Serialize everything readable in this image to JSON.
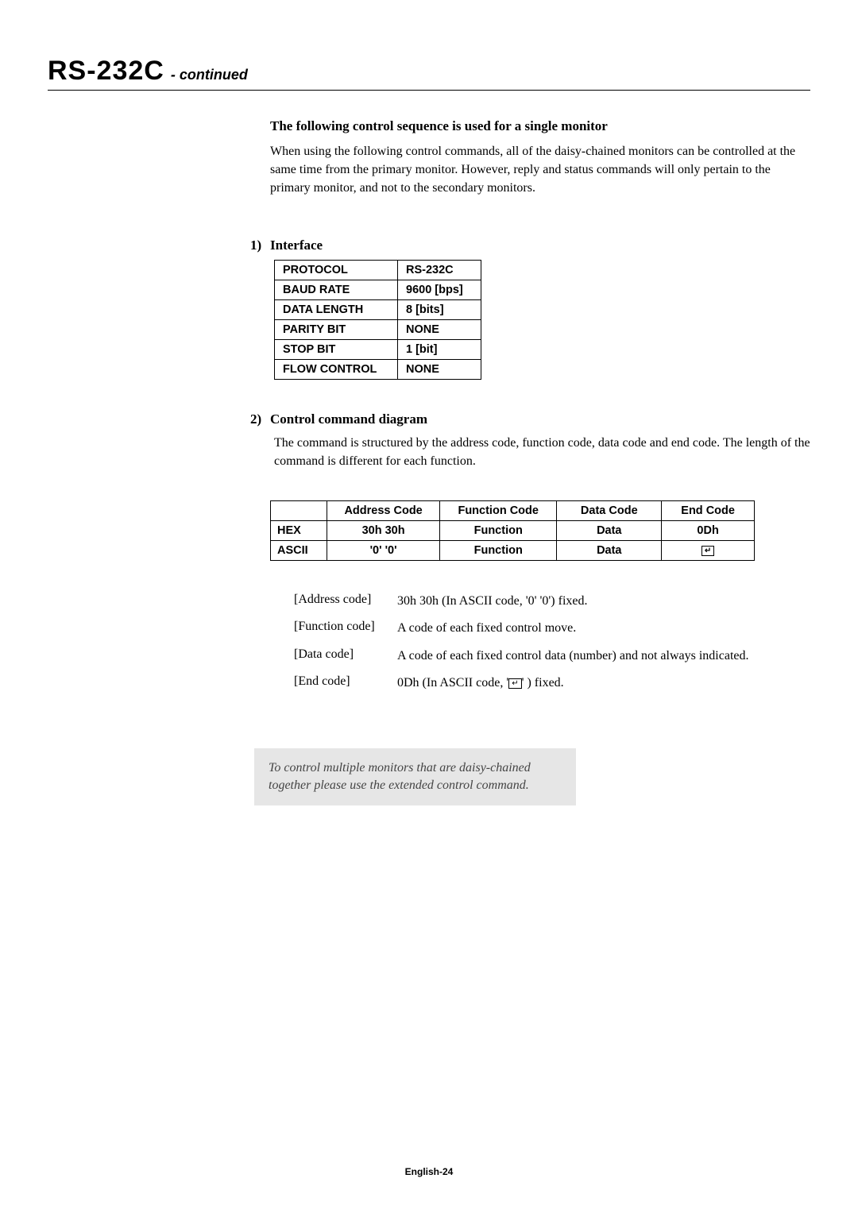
{
  "header": {
    "title": "RS-232C",
    "continued": "- continued"
  },
  "intro": {
    "heading": "The following control sequence is used for a single monitor",
    "paragraph": "When using the following control commands, all of the daisy-chained monitors can be controlled at the same time from the primary monitor. However, reply and status commands will only pertain to the primary monitor, and not to the secondary monitors."
  },
  "section1": {
    "number": "1)",
    "title": "Interface",
    "table": [
      [
        "PROTOCOL",
        "RS-232C"
      ],
      [
        "BAUD RATE",
        "9600 [bps]"
      ],
      [
        "DATA LENGTH",
        "8 [bits]"
      ],
      [
        "PARITY BIT",
        "NONE"
      ],
      [
        "STOP BIT",
        "1 [bit]"
      ],
      [
        "FLOW CONTROL",
        "NONE"
      ]
    ]
  },
  "section2": {
    "number": "2)",
    "title": "Control command diagram",
    "description": "The command is structured by the address code, function code, data code and end code. The length of the command is different for each function.",
    "table": {
      "headers": [
        "",
        "Address Code",
        "Function Code",
        "Data Code",
        "End Code"
      ],
      "rows": [
        [
          "HEX",
          "30h 30h",
          "Function",
          "Data",
          "0Dh"
        ],
        [
          "ASCII",
          "'0' '0'",
          "Function",
          "Data",
          "↵"
        ]
      ]
    },
    "definitions": [
      {
        "label": "[Address code]",
        "value": "30h 30h (In ASCII code, '0' '0') fixed."
      },
      {
        "label": "[Function code]",
        "value": "A code of each fixed control move."
      },
      {
        "label": "[Data code]",
        "value": "A code of each fixed control data (number) and not always indicated."
      },
      {
        "label": "[End code]",
        "value": "0Dh (In ASCII code, ' ↵ ' ) fixed."
      }
    ]
  },
  "note": "To control multiple monitors that are daisy-chained together please use the extended control command.",
  "footer": "English-24"
}
